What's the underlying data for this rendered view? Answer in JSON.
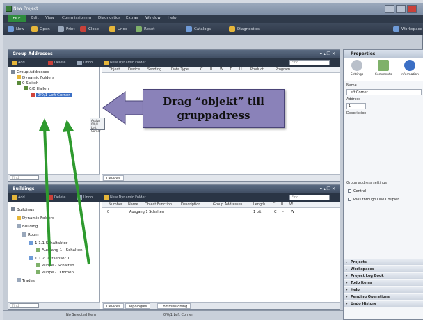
{
  "window": {
    "title": "New Project"
  },
  "menu": [
    "FILE",
    "Edit",
    "View",
    "Commissioning",
    "Diagnostics",
    "Extras",
    "Window",
    "Help"
  ],
  "toolbar": [
    "New",
    "Open",
    "Print",
    "Close",
    "Undo",
    "Reset",
    "Catalogs",
    "Diagnostics",
    "Workspace"
  ],
  "group_panel": {
    "title": "Group Addresses",
    "actions": [
      "Add",
      "Delete",
      "Undo",
      "New Dynamic Folder"
    ],
    "search_placeholder": "Find",
    "tree": [
      "Group Addresses",
      "Dynamic Folders",
      "0 Switch",
      "0/0 Hallen",
      "0/0/1 Left Corner"
    ],
    "columns": [
      "Object",
      "Device",
      "Sending",
      "Data Type",
      "C",
      "R",
      "W",
      "T",
      "U",
      "Product",
      "Program"
    ],
    "drag_tooltip": [
      "Assign",
      "0/0/1 Left Corner"
    ],
    "tree_search_placeholder": "Find",
    "tabs": [
      "Devices"
    ]
  },
  "buildings_panel": {
    "title": "Buildings",
    "actions": [
      "Add",
      "Delete",
      "Undo",
      "New Dynamic Folder"
    ],
    "search_placeholder": "Find",
    "tree": [
      "Buildings",
      "Dynamic Folders",
      "Building",
      "Room",
      "1.1.1 Schaltaktor",
      "Ausgang 1 - Schalten",
      "1.1.2 Tastsensor 1",
      "Wippe - Schalten",
      "Wippe - Dimmen",
      "Trades"
    ],
    "columns": [
      "Number",
      "Name",
      "Object Function",
      "Description",
      "Group Addresses",
      "Length",
      "C",
      "R",
      "W"
    ],
    "row": {
      "number": "0",
      "name": "Ausgang 1 Schalten",
      "length": "1 bit",
      "c": "C",
      "r": "-",
      "w": "W"
    },
    "tree_search_placeholder": "Find",
    "tabs": [
      "Devices",
      "Topologies",
      "Commissioning"
    ]
  },
  "properties": {
    "title": "Properties",
    "tabs": [
      "Settings",
      "Comments",
      "Information"
    ],
    "name_label": "Name",
    "name_value": "Left Corner",
    "address_label": "Address",
    "address_value": "1",
    "description_label": "Description",
    "group_settings_label": "Group address settings",
    "checkbox_central": "Central",
    "checkbox_pass": "Pass through Line Coupler",
    "sections": [
      "Projects",
      "Workspaces",
      "Project Log Book",
      "Todo Items",
      "Help",
      "Pending Operations",
      "Undo History"
    ]
  },
  "callout": {
    "line1": "Drag “objekt” till",
    "line2": "gruppadress"
  },
  "status": {
    "left": "No Selected Item",
    "mid": "0/0/1 Left Corner"
  },
  "colors": {
    "accent_green": "#2e8b3d",
    "arrow_green": "#2e9a2e",
    "callout_fill": "#8a82b9"
  }
}
